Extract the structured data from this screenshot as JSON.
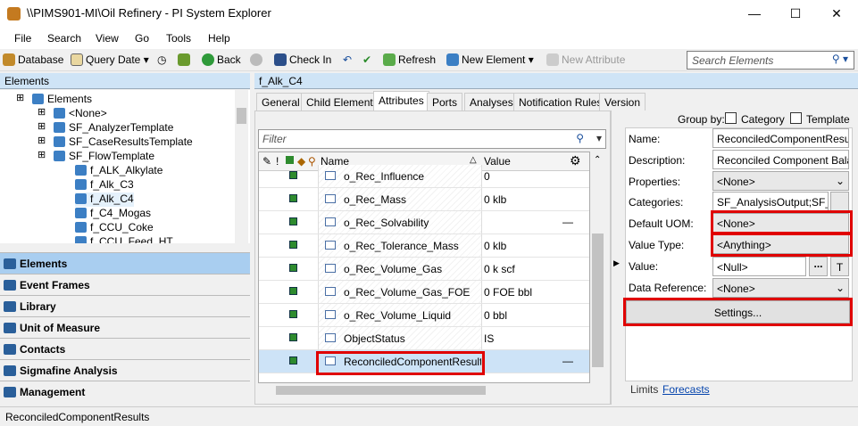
{
  "window": {
    "title": "\\\\PIMS901-MI\\Oil Refinery - PI System Explorer",
    "minimize": "—",
    "maximize": "☐",
    "close": "✕"
  },
  "menu": [
    "File",
    "Search",
    "View",
    "Go",
    "Tools",
    "Help"
  ],
  "toolbar": {
    "database": "Database",
    "query_date": "Query Date",
    "back": "Back",
    "check_in": "Check In",
    "refresh": "Refresh",
    "new_element": "New Element",
    "new_attribute": "New Attribute",
    "search_placeholder": "Search Elements"
  },
  "left": {
    "header": "Elements",
    "tree": [
      {
        "label": "Elements",
        "level": 0
      },
      {
        "label": "<None>",
        "level": 1
      },
      {
        "label": "SF_AnalyzerTemplate",
        "level": 1
      },
      {
        "label": "SF_CaseResultsTemplate",
        "level": 1
      },
      {
        "label": "SF_FlowTemplate",
        "level": 1
      },
      {
        "label": "f_ALK_Alkylate",
        "level": 2
      },
      {
        "label": "f_Alk_C3",
        "level": 2
      },
      {
        "label": "f_Alk_C4",
        "level": 2
      },
      {
        "label": "f_C4_Mogas",
        "level": 2
      },
      {
        "label": "f_CCU_Coke",
        "level": 2
      },
      {
        "label": "f_CCU_Feed_HT",
        "level": 2
      }
    ],
    "nav": [
      "Elements",
      "Event Frames",
      "Library",
      "Unit of Measure",
      "Contacts",
      "Sigmafine Analysis",
      "Management"
    ]
  },
  "main": {
    "header": "f_Alk_C4",
    "tabs": [
      "General",
      "Child Elements",
      "Attributes",
      "Ports",
      "Analyses",
      "Notification Rules",
      "Version"
    ],
    "group_by": "Group by:",
    "group_category": "Category",
    "group_template": "Template",
    "filter_placeholder": "Filter",
    "columns": {
      "name": "Name",
      "value": "Value"
    },
    "rows": [
      {
        "name": "o_Rec_Influence",
        "value": "0"
      },
      {
        "name": "o_Rec_Mass",
        "value": "0 klb"
      },
      {
        "name": "o_Rec_Solvability",
        "value": "",
        "dash": "—"
      },
      {
        "name": "o_Rec_Tolerance_Mass",
        "value": "0 klb"
      },
      {
        "name": "o_Rec_Volume_Gas",
        "value": "0 k scf"
      },
      {
        "name": "o_Rec_Volume_Gas_FOE",
        "value": "0 FOE bbl"
      },
      {
        "name": "o_Rec_Volume_Liquid",
        "value": "0 bbl"
      },
      {
        "name": "ObjectStatus",
        "value": "IS"
      },
      {
        "name": "ReconciledComponentResults",
        "value": "",
        "dash": "—"
      }
    ]
  },
  "details": {
    "name_label": "Name:",
    "name": "ReconciledComponentResults",
    "desc_label": "Description:",
    "desc": "Reconciled Component Balance",
    "props_label": "Properties:",
    "props": "<None>",
    "cat_label": "Categories:",
    "cat": "SF_AnalysisOutput;SF_Co",
    "uom_label": "Default UOM:",
    "uom": "<None>",
    "vt_label": "Value Type:",
    "vt": "<Anything>",
    "val_label": "Value:",
    "val": "<Null>",
    "dots": "...",
    "t": "T",
    "dr_label": "Data Reference:",
    "dr": "<None>",
    "settings": "Settings...",
    "limits": "Limits",
    "forecasts": "Forecasts"
  },
  "status": "ReconciledComponentResults"
}
